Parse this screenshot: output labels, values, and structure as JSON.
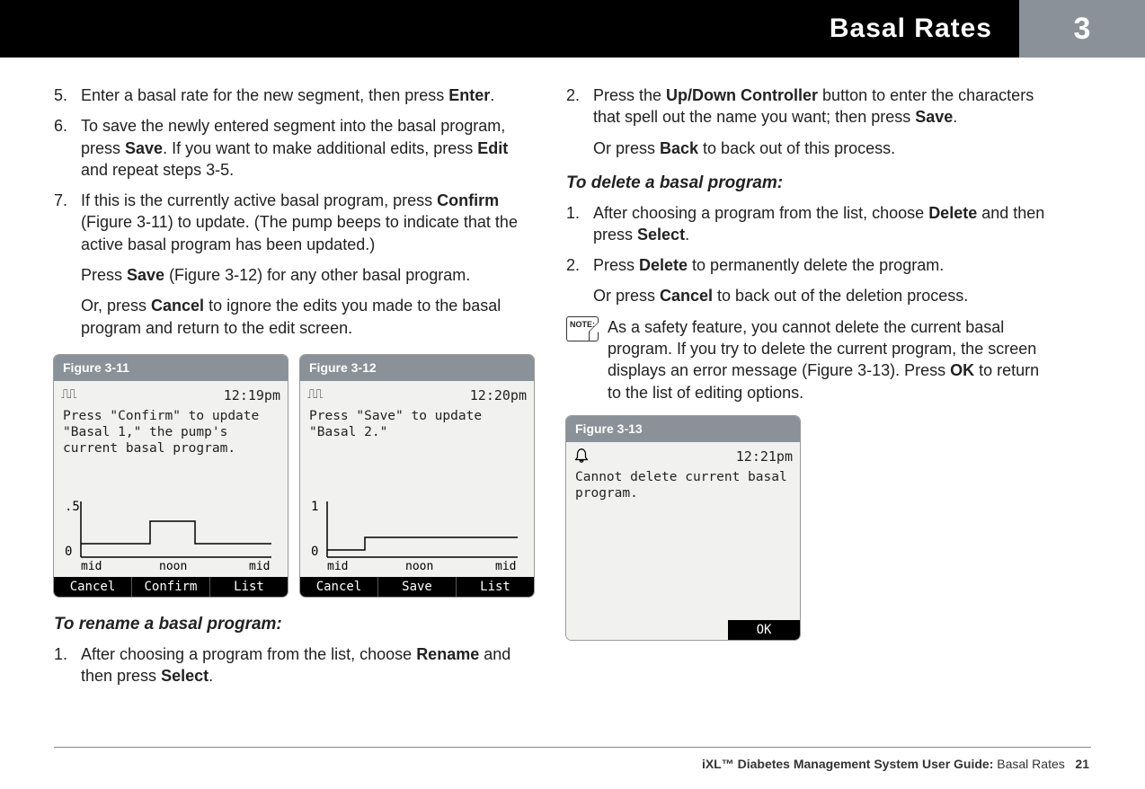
{
  "header": {
    "title": "Basal Rates",
    "chapter": "3"
  },
  "left": {
    "step5": {
      "n": "5.",
      "t1": "Enter a basal rate for the new segment, then press ",
      "b1": "Enter",
      "t2": "."
    },
    "step6": {
      "n": "6.",
      "t1": "To save the newly entered segment into the basal program, press ",
      "b1": "Save",
      "t2": ". If you want to make additional edits, press ",
      "b2": "Edit",
      "t3": " and repeat steps 3-5."
    },
    "step7": {
      "n": "7.",
      "t1": "If this is the currently active basal program, press ",
      "b1": "Confirm",
      "t2": " (Figure 3-11) to update. (The pump beeps to indicate that the active basal program has been updated.)"
    },
    "step7a": {
      "t1": "Press ",
      "b1": "Save",
      "t2": " (Figure 3-12) for any other basal program."
    },
    "step7b": {
      "t1": "Or, press ",
      "b1": "Cancel",
      "t2": " to ignore the edits you made to the basal program and return to the edit screen."
    },
    "rename_head": "To rename a basal program:",
    "rstep1": {
      "n": "1.",
      "t1": "After choosing a program from the list, choose ",
      "b1": "Rename",
      "t2": " and then press ",
      "b2": "Select",
      "t3": "."
    }
  },
  "right": {
    "rstep2": {
      "n": "2.",
      "t1": "Press the ",
      "b1": "Up/Down Controller",
      "t2": " button to enter the characters that spell out the name you want; then press ",
      "b2": "Save",
      "t3": "."
    },
    "rstep2a": {
      "t1": "Or press ",
      "b1": "Back",
      "t2": " to back out of this process."
    },
    "delete_head": "To delete a basal program:",
    "dstep1": {
      "n": "1.",
      "t1": "After choosing a program from the list, choose ",
      "b1": "Delete",
      "t2": " and then press ",
      "b2": "Select",
      "t3": "."
    },
    "dstep2": {
      "n": "2.",
      "t1": "Press ",
      "b1": "Delete",
      "t2": " to permanently delete the program."
    },
    "dstep2a": {
      "t1": "Or press ",
      "b1": "Cancel",
      "t2": " to back out of the deletion process."
    },
    "note": {
      "label": "NOTE:",
      "t1": "As a safety feature, you cannot delete the current basal program. If you try to delete the current program, the screen displays an error message (Figure 3-13). Press ",
      "b1": "OK",
      "t2": " to return to the list of editing options."
    }
  },
  "fig11": {
    "caption": "Figure 3-11",
    "time": "12:19pm",
    "msg": "Press \"Confirm\" to update \"Basal 1,\" the pump's current basal program.",
    "ylabels": [
      ".5",
      "0"
    ],
    "xlabels": [
      "mid",
      "noon",
      "mid"
    ],
    "buttons": [
      "Cancel",
      "Confirm",
      "List"
    ]
  },
  "fig12": {
    "caption": "Figure 3-12",
    "time": "12:20pm",
    "msg": "Press \"Save\" to update \"Basal 2.\"",
    "ylabels": [
      "1",
      "0"
    ],
    "xlabels": [
      "mid",
      "noon",
      "mid"
    ],
    "buttons": [
      "Cancel",
      "Save",
      "List"
    ]
  },
  "fig13": {
    "caption": "Figure 3-13",
    "time": "12:21pm",
    "msg": "Cannot delete current basal program.",
    "button": "OK"
  },
  "footer": {
    "bold": "iXL™ Diabetes Management System User Guide:",
    "plain": " Basal Rates",
    "page": "21"
  }
}
